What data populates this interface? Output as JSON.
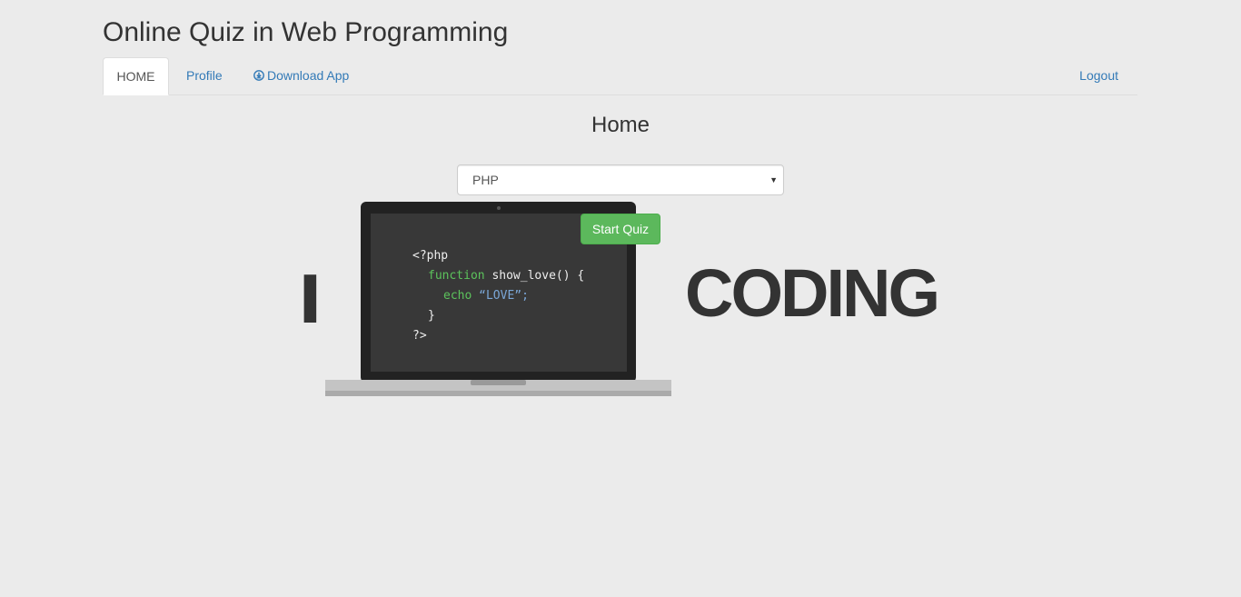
{
  "header": {
    "title": "Online Quiz in Web Programming"
  },
  "nav": {
    "tabs": [
      {
        "label": "HOME",
        "active": true
      },
      {
        "label": "Profile",
        "active": false
      },
      {
        "label": "Download App",
        "active": false,
        "icon": "download-circle-icon"
      }
    ],
    "logout_label": "Logout"
  },
  "main": {
    "heading": "Home",
    "subject_select": {
      "selected": "PHP"
    },
    "start_button_label": "Start Quiz"
  },
  "banner": {
    "left_word": "I",
    "right_word": "CODING",
    "code_lines": [
      "<?php",
      "function",
      " show_love() {",
      "echo",
      " “LOVE”;",
      "}",
      "?>"
    ]
  },
  "colors": {
    "background": "#ebebeb",
    "link": "#337ab7",
    "success": "#5cb85c",
    "code_green": "#5cc35c",
    "code_blue": "#7aa6d6",
    "screen": "#383838"
  }
}
